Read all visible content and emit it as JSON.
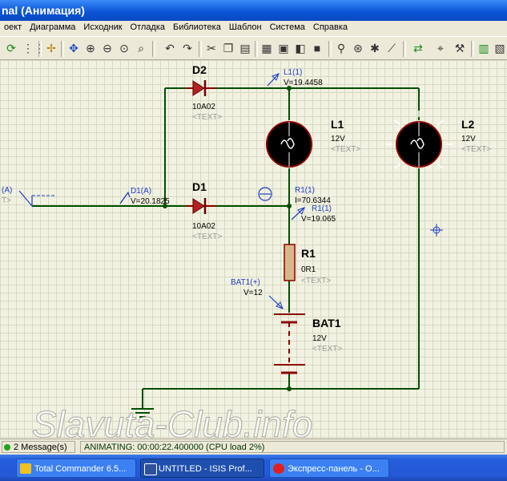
{
  "window": {
    "title": "nal (Анимация)"
  },
  "menu": {
    "items": [
      "оект",
      "Диаграмма",
      "Исходник",
      "Отладка",
      "Библиотека",
      "Шаблон",
      "Система",
      "Справка"
    ]
  },
  "toolbar": {
    "icons": [
      "refresh-icon",
      "grid-icon",
      "origin-icon",
      "pan-icon",
      "zoom-in-icon",
      "zoom-out-icon",
      "zoom-all-icon",
      "zoom-area-icon",
      "undo-icon",
      "redo-icon",
      "cut-icon",
      "copy-icon",
      "paste-icon",
      "block-copy-icon",
      "block-move-icon",
      "block-rotate-icon",
      "block-delete-icon",
      "pick-icon",
      "make-device-icon",
      "package-icon",
      "decompose-icon",
      "wire-autorouter-icon",
      "search-icon",
      "property-tool-icon",
      "netlist-icon",
      "bom-icon"
    ]
  },
  "schematic": {
    "left_probe": {
      "label": "(A)",
      "sub": "T>"
    },
    "d2": {
      "name": "D2",
      "type": "10A02",
      "text": "<TEXT>"
    },
    "d1": {
      "name": "D1",
      "type": "10A02",
      "text": "<TEXT>"
    },
    "l1": {
      "name": "L1",
      "value": "12V",
      "text": "<TEXT>"
    },
    "l2": {
      "name": "L2",
      "value": "12V",
      "text": "<TEXT>"
    },
    "r1": {
      "name": "R1",
      "value": "0R1",
      "text": "<TEXT>"
    },
    "bat1": {
      "name": "BAT1",
      "value": "12V",
      "text": "<TEXT>"
    },
    "probes": {
      "l1_probe": {
        "label": "L1(1)",
        "value": "V=19.4458"
      },
      "d1_probe": {
        "label": "D1(A)",
        "value": "V=20.1825"
      },
      "r1_current": {
        "label": "R1(1)",
        "value": "I=70.6344"
      },
      "r1_voltage": {
        "label": "R1(1)",
        "value": "V=19.065"
      },
      "bat_probe": {
        "label": "BAT1(+)",
        "value": "V=12"
      }
    },
    "watermark": "Slavuta-Club.info"
  },
  "status": {
    "messages": "2 Message(s)",
    "animating": "ANIMATING: 00:00:22.400000 (CPU load 2%)"
  },
  "taskbar": {
    "items": [
      {
        "label": "Total Commander 6.5...",
        "color": "#f0c020"
      },
      {
        "label": "UNTITLED - ISIS Prof...",
        "color": "#3050a0"
      },
      {
        "label": "Экспресс-панель - О...",
        "color": "#e02020"
      }
    ]
  }
}
